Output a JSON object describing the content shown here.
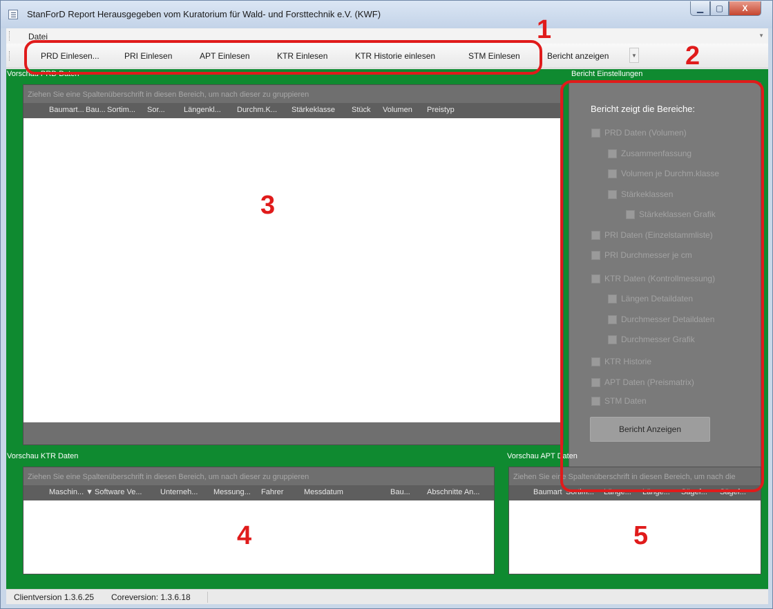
{
  "window": {
    "title": "StanForD Report   Herausgegeben vom Kuratorium für Wald- und Forsttechnik e.V. (KWF)",
    "controls": {
      "minimize": "▁",
      "maximize": "▢",
      "close": "X"
    }
  },
  "menu": {
    "items": [
      "Datei"
    ]
  },
  "toolbar": {
    "buttons": [
      "PRD Einlesen...",
      "PRI Einlesen",
      "APT Einlesen",
      "KTR Einlesen",
      "KTR Historie einlesen",
      "STM Einlesen",
      "Bericht anzeigen"
    ],
    "dropdown_icon": "▼"
  },
  "prd_panel": {
    "title": "Vorschau PRD Daten",
    "group_hint": "Ziehen Sie eine Spaltenüberschrift in diesen Bereich, um nach dieser zu gruppieren",
    "columns": [
      "Baumart...",
      "Bau...",
      "Sortim...",
      "Sor...",
      "Längenkl...",
      "Durchm.K...",
      "Stärkeklasse",
      "Stück",
      "Volumen",
      "Preistyp"
    ]
  },
  "ktr_panel": {
    "title": "Vorschau KTR Daten",
    "group_hint": "Ziehen Sie eine Spaltenüberschrift in diesen Bereich, um nach dieser zu gruppieren",
    "columns": [
      "Maschin... ▼",
      "Software Ve...",
      "Unterneh...",
      "Messung...",
      "Fahrer",
      "Messdatum",
      "Bau...",
      "Abschnitte An..."
    ]
  },
  "apt_panel": {
    "title": "Vorschau APT Daten",
    "group_hint": "Ziehen Sie eine Spaltenüberschrift in diesen Bereich, um nach die",
    "columns": [
      "Baumart",
      "Sortim...",
      "Länge...",
      "Länge...",
      "Sägef...",
      "Sägef..."
    ]
  },
  "settings": {
    "group_title": "Bericht Einstellungen",
    "heading": "Bericht zeigt die Bereiche:",
    "options": [
      "PRD Daten (Volumen)",
      "Zusammenfassung",
      "Volumen je Durchm.klasse",
      "Stärkeklassen",
      "Stärkeklassen Grafik",
      "PRI Daten (Einzelstammliste)",
      "PRI Durchmesser je cm",
      "KTR Daten (Kontrollmessung)",
      "Längen Detaildaten",
      "Durchmesser Detaildaten",
      "Durchmesser Grafik",
      "KTR Historie",
      "APT Daten (Preismatrix)",
      "STM Daten"
    ],
    "button_label": "Bericht Anzeigen"
  },
  "annotations": [
    "1",
    "2",
    "3",
    "4",
    "5"
  ],
  "status": {
    "client_version": "Clientversion 1.3.6.25",
    "core_version": "Coreversion: 1.3.6.18"
  },
  "colors": {
    "workspace": "#0f8a30",
    "annotation": "#e01b1b",
    "panel": "#6f6f6f"
  }
}
